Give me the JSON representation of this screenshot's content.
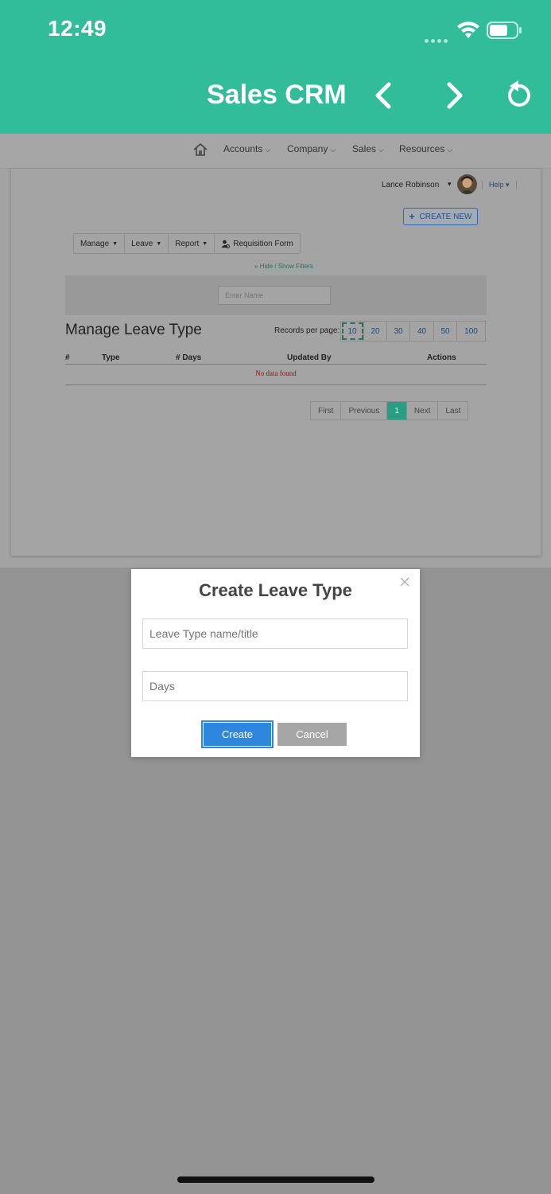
{
  "status_bar": {
    "time": "12:49"
  },
  "app": {
    "title": "Sales CRM"
  },
  "menu": {
    "items": [
      {
        "label": "Accounts"
      },
      {
        "label": "Company"
      },
      {
        "label": "Sales"
      },
      {
        "label": "Resources"
      }
    ]
  },
  "user": {
    "name": "Lance Robinson",
    "help": "Help"
  },
  "actions": {
    "create_new": "CREATE NEW"
  },
  "toolbar": {
    "manage": "Manage",
    "leave": "Leave",
    "report": "Report",
    "requisition": "Requisition Form"
  },
  "filters": {
    "toggle": "Hide / Show Filters",
    "name_placeholder": "Enter Name"
  },
  "section": {
    "title": "Manage Leave Type"
  },
  "records_per_page": {
    "label": "Records per page:",
    "options": [
      "10",
      "20",
      "30",
      "40",
      "50",
      "100"
    ],
    "selected": "10"
  },
  "table": {
    "columns": [
      "#",
      "Type",
      "# Days",
      "Updated By",
      "Actions"
    ],
    "empty_text": "No data found"
  },
  "pagination": {
    "first": "First",
    "previous": "Previous",
    "current": "1",
    "next": "Next",
    "last": "Last"
  },
  "modal": {
    "title": "Create Leave Type",
    "name_placeholder": "Leave Type name/title",
    "days_placeholder": "Days",
    "create_label": "Create",
    "cancel_label": "Cancel"
  },
  "colors": {
    "brand": "#32bd9a",
    "primary_button": "#2e86de",
    "cancel_button": "#a5a5a5",
    "overlay": "#949494"
  }
}
